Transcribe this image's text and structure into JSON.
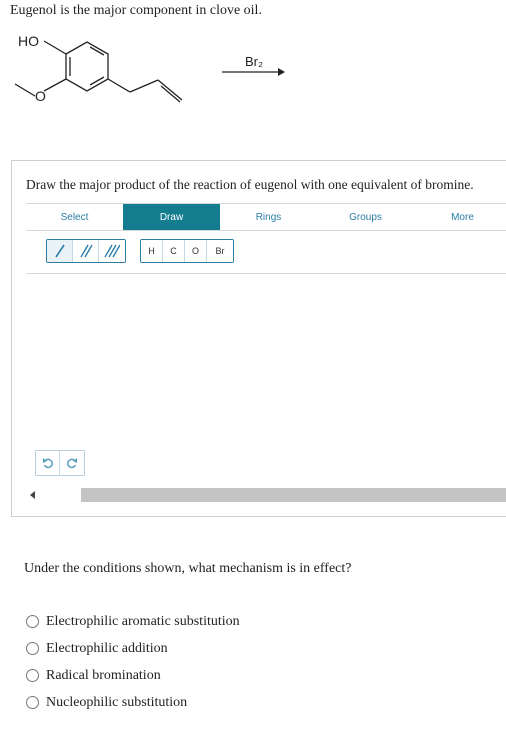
{
  "intro_text": "Eugenol is the major component in clove oil.",
  "molecule": {
    "hydroxyl_label": "HO",
    "methoxy_label": "O"
  },
  "reagent": {
    "label": "Br₂"
  },
  "prompt": "Draw the major product of the reaction of eugenol with one equivalent of bromine.",
  "tabs": [
    {
      "label": "Select",
      "active": false
    },
    {
      "label": "Draw",
      "active": true
    },
    {
      "label": "Rings",
      "active": false
    },
    {
      "label": "Groups",
      "active": false
    },
    {
      "label": "More",
      "active": false
    }
  ],
  "bond_tools": [
    {
      "icon": "single-bond-icon",
      "selected": true
    },
    {
      "icon": "double-bond-icon",
      "selected": false
    },
    {
      "icon": "triple-bond-icon",
      "selected": false
    }
  ],
  "atom_tools": [
    "H",
    "C",
    "O",
    "Br"
  ],
  "history_tools": [
    {
      "icon": "undo-icon"
    },
    {
      "icon": "redo-icon"
    }
  ],
  "colors": {
    "accent": "#137c8f",
    "link": "#2b7da6",
    "scroll_thumb": "#c4c4c4"
  },
  "question": "Under the conditions shown, what mechanism is in effect?",
  "options": [
    "Electrophilic aromatic substitution",
    "Electrophilic addition",
    "Radical bromination",
    "Nucleophilic substitution"
  ]
}
